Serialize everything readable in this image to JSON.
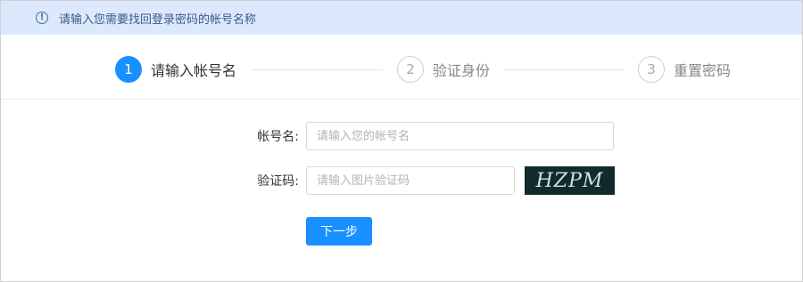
{
  "notice": {
    "icon": "info-icon",
    "text": "请输入您需要找回登录密码的帐号名称"
  },
  "steps": [
    {
      "number": "1",
      "label": "请输入帐号名",
      "state": "active"
    },
    {
      "number": "2",
      "label": "验证身份",
      "state": "inactive"
    },
    {
      "number": "3",
      "label": "重置密码",
      "state": "inactive"
    }
  ],
  "form": {
    "account": {
      "label": "帐号名:",
      "placeholder": "请输入您的帐号名",
      "value": ""
    },
    "captcha": {
      "label": "验证码:",
      "placeholder": "请输入图片验证码",
      "value": "",
      "image_text": "HZPM"
    },
    "next_button": "下一步"
  },
  "colors": {
    "accent": "#1890ff",
    "notice_bg": "#dce8fc"
  }
}
